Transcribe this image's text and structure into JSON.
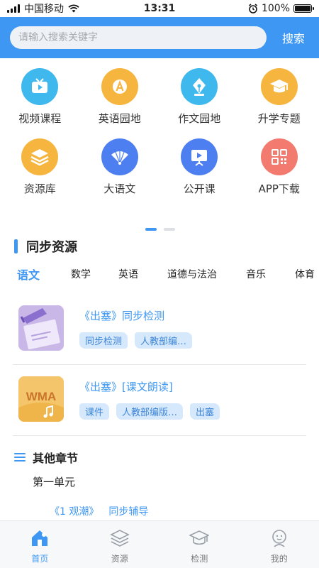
{
  "status_bar": {
    "carrier": "中国移动",
    "time": "13:31",
    "battery": "100%",
    "battery_level": 1.0
  },
  "search": {
    "placeholder": "请输入搜索关键字",
    "button_label": "搜索"
  },
  "grid": [
    {
      "label": "视频课程",
      "icon": "video-course-icon",
      "color": "#3fb8ee"
    },
    {
      "label": "英语园地",
      "icon": "english-icon",
      "color": "#f6b53e"
    },
    {
      "label": "作文园地",
      "icon": "pen-icon",
      "color": "#3fb8ee"
    },
    {
      "label": "升学专题",
      "icon": "graduation-cap-icon",
      "color": "#f6b53e"
    },
    {
      "label": "资源库",
      "icon": "layers-icon",
      "color": "#f6b53e"
    },
    {
      "label": "大语文",
      "icon": "fan-icon",
      "color": "#4d7ff0"
    },
    {
      "label": "公开课",
      "icon": "presentation-icon",
      "color": "#4d7ff0"
    },
    {
      "label": "APP下载",
      "icon": "qr-code-icon",
      "color": "#f37a6e"
    }
  ],
  "pager": {
    "pages": 2,
    "current": 1
  },
  "section": {
    "title": "同步资源"
  },
  "tabs": [
    "语文",
    "数学",
    "英语",
    "道德与法治",
    "音乐",
    "体育"
  ],
  "active_tab": "语文",
  "resources": [
    {
      "title": "《出塞》同步检测",
      "thumb": "exam-thumbnail",
      "tags": [
        "同步检测",
        "人教部编…"
      ]
    },
    {
      "title": "《出塞》[课文朗读]",
      "thumb": "wma-audio-thumbnail",
      "thumb_text": "WMA",
      "tags": [
        "课件",
        "人教部编版…",
        "出塞"
      ]
    }
  ],
  "other": {
    "title": "其他章节",
    "unit": "第一单元",
    "lesson_title": "《1 观潮》",
    "lesson_type": "同步辅导"
  },
  "bottom_nav": [
    {
      "label": "首页",
      "icon": "home-icon",
      "active": true
    },
    {
      "label": "资源",
      "icon": "layers-icon",
      "active": false
    },
    {
      "label": "检测",
      "icon": "graduation-cap-icon",
      "active": false
    },
    {
      "label": "我的",
      "icon": "user-icon",
      "active": false
    }
  ]
}
